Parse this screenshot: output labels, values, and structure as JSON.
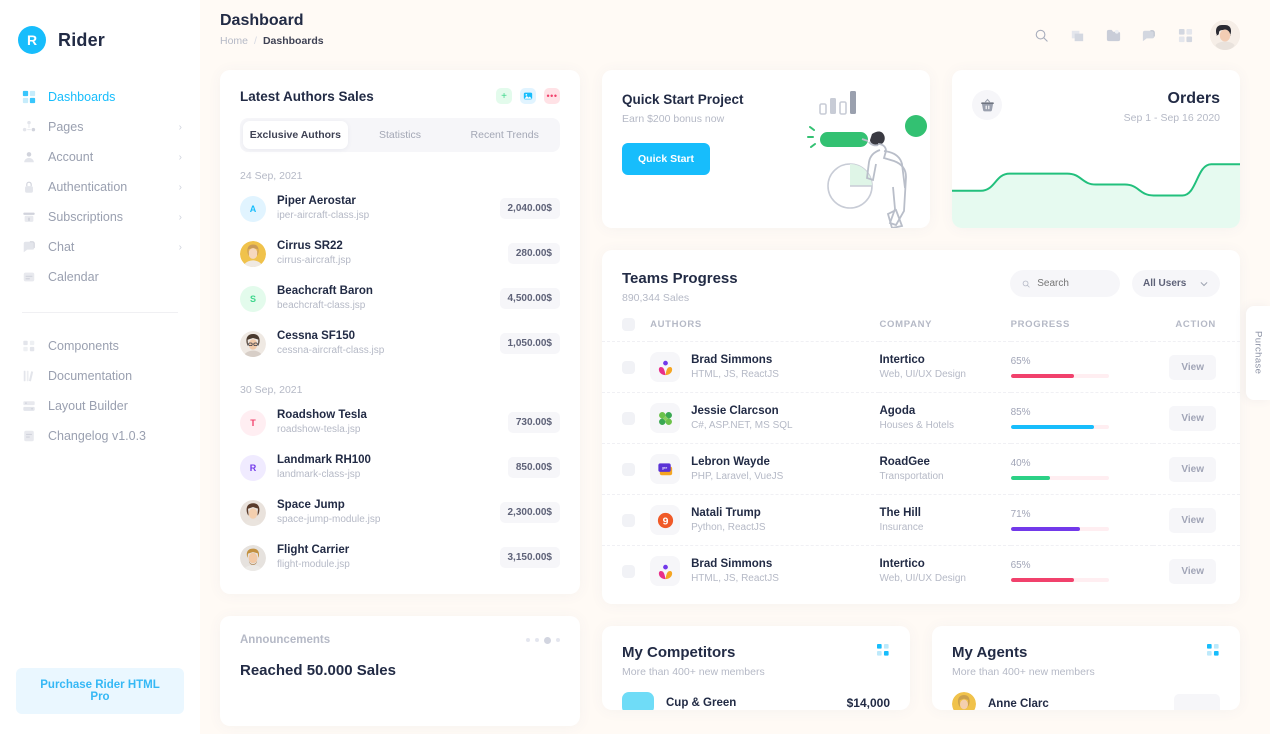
{
  "brand": {
    "logo_letter": "R",
    "name": "Rider"
  },
  "sidebar": {
    "items": [
      {
        "label": "Dashboards",
        "icon": "grid-icon",
        "active": true,
        "chevron": false
      },
      {
        "label": "Pages",
        "icon": "pages-icon",
        "active": false,
        "chevron": true
      },
      {
        "label": "Account",
        "icon": "account-icon",
        "active": false,
        "chevron": true
      },
      {
        "label": "Authentication",
        "icon": "lock-icon",
        "active": false,
        "chevron": true
      },
      {
        "label": "Subscriptions",
        "icon": "subscriptions-icon",
        "active": false,
        "chevron": true
      },
      {
        "label": "Chat",
        "icon": "chat-icon",
        "active": false,
        "chevron": true
      },
      {
        "label": "Calendar",
        "icon": "calendar-icon",
        "active": false,
        "chevron": false
      }
    ],
    "items2": [
      {
        "label": "Components",
        "icon": "components-icon"
      },
      {
        "label": "Documentation",
        "icon": "documentation-icon"
      },
      {
        "label": "Layout Builder",
        "icon": "layout-builder-icon"
      },
      {
        "label": "Changelog v1.0.3",
        "icon": "changelog-icon"
      }
    ],
    "purchase_label": "Purchase Rider HTML Pro"
  },
  "header": {
    "title": "Dashboard",
    "breadcrumb": {
      "home": "Home",
      "sep": "/",
      "current": "Dashboards"
    },
    "icons": [
      "search-icon",
      "layers-icon",
      "folder-icon",
      "chat-bubble-icon",
      "grid-icon"
    ],
    "avatar": "user-avatar"
  },
  "latest_authors": {
    "title": "Latest Authors Sales",
    "actions": [
      {
        "icon": "plus-icon",
        "glyph": "+"
      },
      {
        "icon": "image-icon",
        "glyph": ""
      },
      {
        "icon": "more-icon",
        "glyph": "•••"
      }
    ],
    "tabs": [
      {
        "label": "Exclusive Authors",
        "active": true
      },
      {
        "label": "Statistics",
        "active": false
      },
      {
        "label": "Recent Trends",
        "active": false
      }
    ],
    "groups": [
      {
        "date": "24 Sep, 2021",
        "rows": [
          {
            "avatar_type": "letter",
            "letter": "A",
            "bg": "#e1f4ff",
            "fg": "#17bdfc",
            "name": "Piper Aerostar",
            "file": "iper-aircraft-class.jsp",
            "amount": "2,040.00$"
          },
          {
            "avatar_type": "photo",
            "photo": "woman-blonde",
            "name": "Cirrus SR22",
            "file": "cirrus-aircraft.jsp",
            "amount": "280.00$"
          },
          {
            "avatar_type": "letter",
            "letter": "S",
            "bg": "#e3fbec",
            "fg": "#3dd68c",
            "name": "Beachcraft Baron",
            "file": "beachcraft-class.jsp",
            "amount": "4,500.00$"
          },
          {
            "avatar_type": "photo",
            "photo": "woman-glasses",
            "name": "Cessna SF150",
            "file": "cessna-aircraft-class.jsp",
            "amount": "1,050.00$"
          }
        ]
      },
      {
        "date": "30 Sep, 2021",
        "rows": [
          {
            "avatar_type": "letter",
            "letter": "T",
            "bg": "#ffeef2",
            "fg": "#f1416c",
            "name": "Roadshow Tesla",
            "file": "roadshow-tesla.jsp",
            "amount": "730.00$"
          },
          {
            "avatar_type": "letter",
            "letter": "R",
            "bg": "#f0ebff",
            "fg": "#7239ea",
            "name": "Landmark RH100",
            "file": "landmark-class-jsp",
            "amount": "850.00$"
          },
          {
            "avatar_type": "photo",
            "photo": "woman-brunette",
            "name": "Space Jump",
            "file": "space-jump-module.jsp",
            "amount": "2,300.00$"
          },
          {
            "avatar_type": "photo",
            "photo": "man-beard",
            "name": "Flight Carrier",
            "file": "flight-module.jsp",
            "amount": "3,150.00$"
          }
        ]
      }
    ]
  },
  "announcements": {
    "label": "Announcements",
    "title": "Reached 50.000 Sales",
    "dots": 4,
    "active_dot": 2
  },
  "quick_start": {
    "title": "Quick Start Project",
    "subtitle": "Earn $200 bonus now",
    "button": "Quick Start",
    "illustration": "person-with-charts-illustration"
  },
  "orders": {
    "title": "Orders",
    "range": "Sep 1 - Sep 16 2020",
    "icon": "basket-icon",
    "accent": "#22c07d",
    "fill": "#e6faf0"
  },
  "chart_data": {
    "type": "area",
    "title": "Orders",
    "subtitle": "Sep 1 - Sep 16 2020",
    "x": [
      0,
      1,
      2,
      3,
      4,
      5,
      6,
      7,
      8,
      9,
      10
    ],
    "values": [
      40,
      40,
      62,
      62,
      62,
      48,
      48,
      34,
      34,
      74,
      74
    ],
    "xlabel": "",
    "ylabel": "",
    "ylim": [
      0,
      100
    ],
    "grid": false,
    "legend": false,
    "line_color": "#22c07d",
    "fill_color": "#e6faf0"
  },
  "teams_progress": {
    "title": "Teams Progress",
    "subtitle": "890,344 Sales",
    "search_placeholder": "Search",
    "search_value": "",
    "filter_label": "All Users",
    "columns": [
      "",
      "AUTHORS",
      "COMPANY",
      "PROGRESS",
      "ACTION"
    ],
    "rows": [
      {
        "logo": "intertico-logo",
        "name": "Brad Simmons",
        "skills": "HTML, JS, ReactJS",
        "company": "Intertico",
        "industry": "Web, UI/UX Design",
        "progress": "65%",
        "progress_value": 65,
        "bar_color": "#f1416c",
        "action": "View"
      },
      {
        "logo": "agoda-logo",
        "name": "Jessie Clarcson",
        "skills": "C#, ASP.NET, MS SQL",
        "company": "Agoda",
        "industry": "Houses & Hotels",
        "progress": "85%",
        "progress_value": 85,
        "bar_color": "#17bdfc",
        "action": "View"
      },
      {
        "logo": "roadgee-logo",
        "name": "Lebron Wayde",
        "skills": "PHP, Laravel, VueJS",
        "company": "RoadGee",
        "industry": "Transportation",
        "progress": "40%",
        "progress_value": 40,
        "bar_color": "#2cd186",
        "action": "View"
      },
      {
        "logo": "thehill-logo",
        "name": "Natali Trump",
        "skills": "Python, ReactJS",
        "company": "The Hill",
        "industry": "Insurance",
        "progress": "71%",
        "progress_value": 71,
        "bar_color": "#7239ea",
        "action": "View"
      },
      {
        "logo": "intertico-logo",
        "name": "Brad Simmons",
        "skills": "HTML, JS, ReactJS",
        "company": "Intertico",
        "industry": "Web, UI/UX Design",
        "progress": "65%",
        "progress_value": 65,
        "bar_color": "#f1416c",
        "action": "View"
      }
    ]
  },
  "my_competitors": {
    "title": "My Competitors",
    "subtitle": "More than 400+ new members",
    "menu_icon": "grid-dots-icon",
    "row": {
      "logo": "cup-green-logo",
      "name": "Cup & Green",
      "value": "$14,000"
    }
  },
  "my_agents": {
    "title": "My Agents",
    "subtitle": "More than 400+ new members",
    "menu_icon": "grid-dots-icon",
    "row": {
      "avatar": "anne-clarc-avatar",
      "name": "Anne Clarc"
    }
  },
  "side_tab": {
    "label": "Purchase"
  }
}
